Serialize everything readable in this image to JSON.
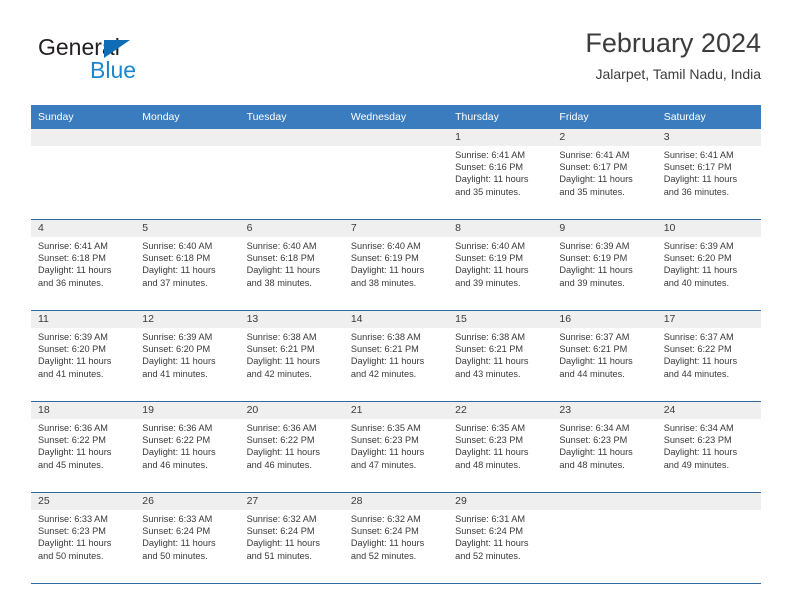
{
  "brand": {
    "name_part1": "General",
    "name_part2": "Blue",
    "logo_icon": "triangle-logo-icon"
  },
  "header": {
    "title": "February 2024",
    "subtitle": "Jalarpet, Tamil Nadu, India"
  },
  "colors": {
    "header_blue": "#3b7cbf",
    "row_divider_blue": "#2e6da4",
    "daynum_strip_gray": "#efefef",
    "brand_blue": "#1b87d2",
    "logo_blue": "#0f6cb5",
    "text": "#3a3a3a"
  },
  "weekday_headers": [
    "Sunday",
    "Monday",
    "Tuesday",
    "Wednesday",
    "Thursday",
    "Friday",
    "Saturday"
  ],
  "weeks": [
    [
      {
        "day": "",
        "empty": true
      },
      {
        "day": "",
        "empty": true
      },
      {
        "day": "",
        "empty": true
      },
      {
        "day": "",
        "empty": true
      },
      {
        "day": "1",
        "sunrise": "Sunrise: 6:41 AM",
        "sunset": "Sunset: 6:16 PM",
        "daylight1": "Daylight: 11 hours",
        "daylight2": "and 35 minutes."
      },
      {
        "day": "2",
        "sunrise": "Sunrise: 6:41 AM",
        "sunset": "Sunset: 6:17 PM",
        "daylight1": "Daylight: 11 hours",
        "daylight2": "and 35 minutes."
      },
      {
        "day": "3",
        "sunrise": "Sunrise: 6:41 AM",
        "sunset": "Sunset: 6:17 PM",
        "daylight1": "Daylight: 11 hours",
        "daylight2": "and 36 minutes."
      }
    ],
    [
      {
        "day": "4",
        "sunrise": "Sunrise: 6:41 AM",
        "sunset": "Sunset: 6:18 PM",
        "daylight1": "Daylight: 11 hours",
        "daylight2": "and 36 minutes."
      },
      {
        "day": "5",
        "sunrise": "Sunrise: 6:40 AM",
        "sunset": "Sunset: 6:18 PM",
        "daylight1": "Daylight: 11 hours",
        "daylight2": "and 37 minutes."
      },
      {
        "day": "6",
        "sunrise": "Sunrise: 6:40 AM",
        "sunset": "Sunset: 6:18 PM",
        "daylight1": "Daylight: 11 hours",
        "daylight2": "and 38 minutes."
      },
      {
        "day": "7",
        "sunrise": "Sunrise: 6:40 AM",
        "sunset": "Sunset: 6:19 PM",
        "daylight1": "Daylight: 11 hours",
        "daylight2": "and 38 minutes."
      },
      {
        "day": "8",
        "sunrise": "Sunrise: 6:40 AM",
        "sunset": "Sunset: 6:19 PM",
        "daylight1": "Daylight: 11 hours",
        "daylight2": "and 39 minutes."
      },
      {
        "day": "9",
        "sunrise": "Sunrise: 6:39 AM",
        "sunset": "Sunset: 6:19 PM",
        "daylight1": "Daylight: 11 hours",
        "daylight2": "and 39 minutes."
      },
      {
        "day": "10",
        "sunrise": "Sunrise: 6:39 AM",
        "sunset": "Sunset: 6:20 PM",
        "daylight1": "Daylight: 11 hours",
        "daylight2": "and 40 minutes."
      }
    ],
    [
      {
        "day": "11",
        "sunrise": "Sunrise: 6:39 AM",
        "sunset": "Sunset: 6:20 PM",
        "daylight1": "Daylight: 11 hours",
        "daylight2": "and 41 minutes."
      },
      {
        "day": "12",
        "sunrise": "Sunrise: 6:39 AM",
        "sunset": "Sunset: 6:20 PM",
        "daylight1": "Daylight: 11 hours",
        "daylight2": "and 41 minutes."
      },
      {
        "day": "13",
        "sunrise": "Sunrise: 6:38 AM",
        "sunset": "Sunset: 6:21 PM",
        "daylight1": "Daylight: 11 hours",
        "daylight2": "and 42 minutes."
      },
      {
        "day": "14",
        "sunrise": "Sunrise: 6:38 AM",
        "sunset": "Sunset: 6:21 PM",
        "daylight1": "Daylight: 11 hours",
        "daylight2": "and 42 minutes."
      },
      {
        "day": "15",
        "sunrise": "Sunrise: 6:38 AM",
        "sunset": "Sunset: 6:21 PM",
        "daylight1": "Daylight: 11 hours",
        "daylight2": "and 43 minutes."
      },
      {
        "day": "16",
        "sunrise": "Sunrise: 6:37 AM",
        "sunset": "Sunset: 6:21 PM",
        "daylight1": "Daylight: 11 hours",
        "daylight2": "and 44 minutes."
      },
      {
        "day": "17",
        "sunrise": "Sunrise: 6:37 AM",
        "sunset": "Sunset: 6:22 PM",
        "daylight1": "Daylight: 11 hours",
        "daylight2": "and 44 minutes."
      }
    ],
    [
      {
        "day": "18",
        "sunrise": "Sunrise: 6:36 AM",
        "sunset": "Sunset: 6:22 PM",
        "daylight1": "Daylight: 11 hours",
        "daylight2": "and 45 minutes."
      },
      {
        "day": "19",
        "sunrise": "Sunrise: 6:36 AM",
        "sunset": "Sunset: 6:22 PM",
        "daylight1": "Daylight: 11 hours",
        "daylight2": "and 46 minutes."
      },
      {
        "day": "20",
        "sunrise": "Sunrise: 6:36 AM",
        "sunset": "Sunset: 6:22 PM",
        "daylight1": "Daylight: 11 hours",
        "daylight2": "and 46 minutes."
      },
      {
        "day": "21",
        "sunrise": "Sunrise: 6:35 AM",
        "sunset": "Sunset: 6:23 PM",
        "daylight1": "Daylight: 11 hours",
        "daylight2": "and 47 minutes."
      },
      {
        "day": "22",
        "sunrise": "Sunrise: 6:35 AM",
        "sunset": "Sunset: 6:23 PM",
        "daylight1": "Daylight: 11 hours",
        "daylight2": "and 48 minutes."
      },
      {
        "day": "23",
        "sunrise": "Sunrise: 6:34 AM",
        "sunset": "Sunset: 6:23 PM",
        "daylight1": "Daylight: 11 hours",
        "daylight2": "and 48 minutes."
      },
      {
        "day": "24",
        "sunrise": "Sunrise: 6:34 AM",
        "sunset": "Sunset: 6:23 PM",
        "daylight1": "Daylight: 11 hours",
        "daylight2": "and 49 minutes."
      }
    ],
    [
      {
        "day": "25",
        "sunrise": "Sunrise: 6:33 AM",
        "sunset": "Sunset: 6:23 PM",
        "daylight1": "Daylight: 11 hours",
        "daylight2": "and 50 minutes."
      },
      {
        "day": "26",
        "sunrise": "Sunrise: 6:33 AM",
        "sunset": "Sunset: 6:24 PM",
        "daylight1": "Daylight: 11 hours",
        "daylight2": "and 50 minutes."
      },
      {
        "day": "27",
        "sunrise": "Sunrise: 6:32 AM",
        "sunset": "Sunset: 6:24 PM",
        "daylight1": "Daylight: 11 hours",
        "daylight2": "and 51 minutes."
      },
      {
        "day": "28",
        "sunrise": "Sunrise: 6:32 AM",
        "sunset": "Sunset: 6:24 PM",
        "daylight1": "Daylight: 11 hours",
        "daylight2": "and 52 minutes."
      },
      {
        "day": "29",
        "sunrise": "Sunrise: 6:31 AM",
        "sunset": "Sunset: 6:24 PM",
        "daylight1": "Daylight: 11 hours",
        "daylight2": "and 52 minutes."
      },
      {
        "day": "",
        "empty": true
      },
      {
        "day": "",
        "empty": true
      }
    ]
  ]
}
